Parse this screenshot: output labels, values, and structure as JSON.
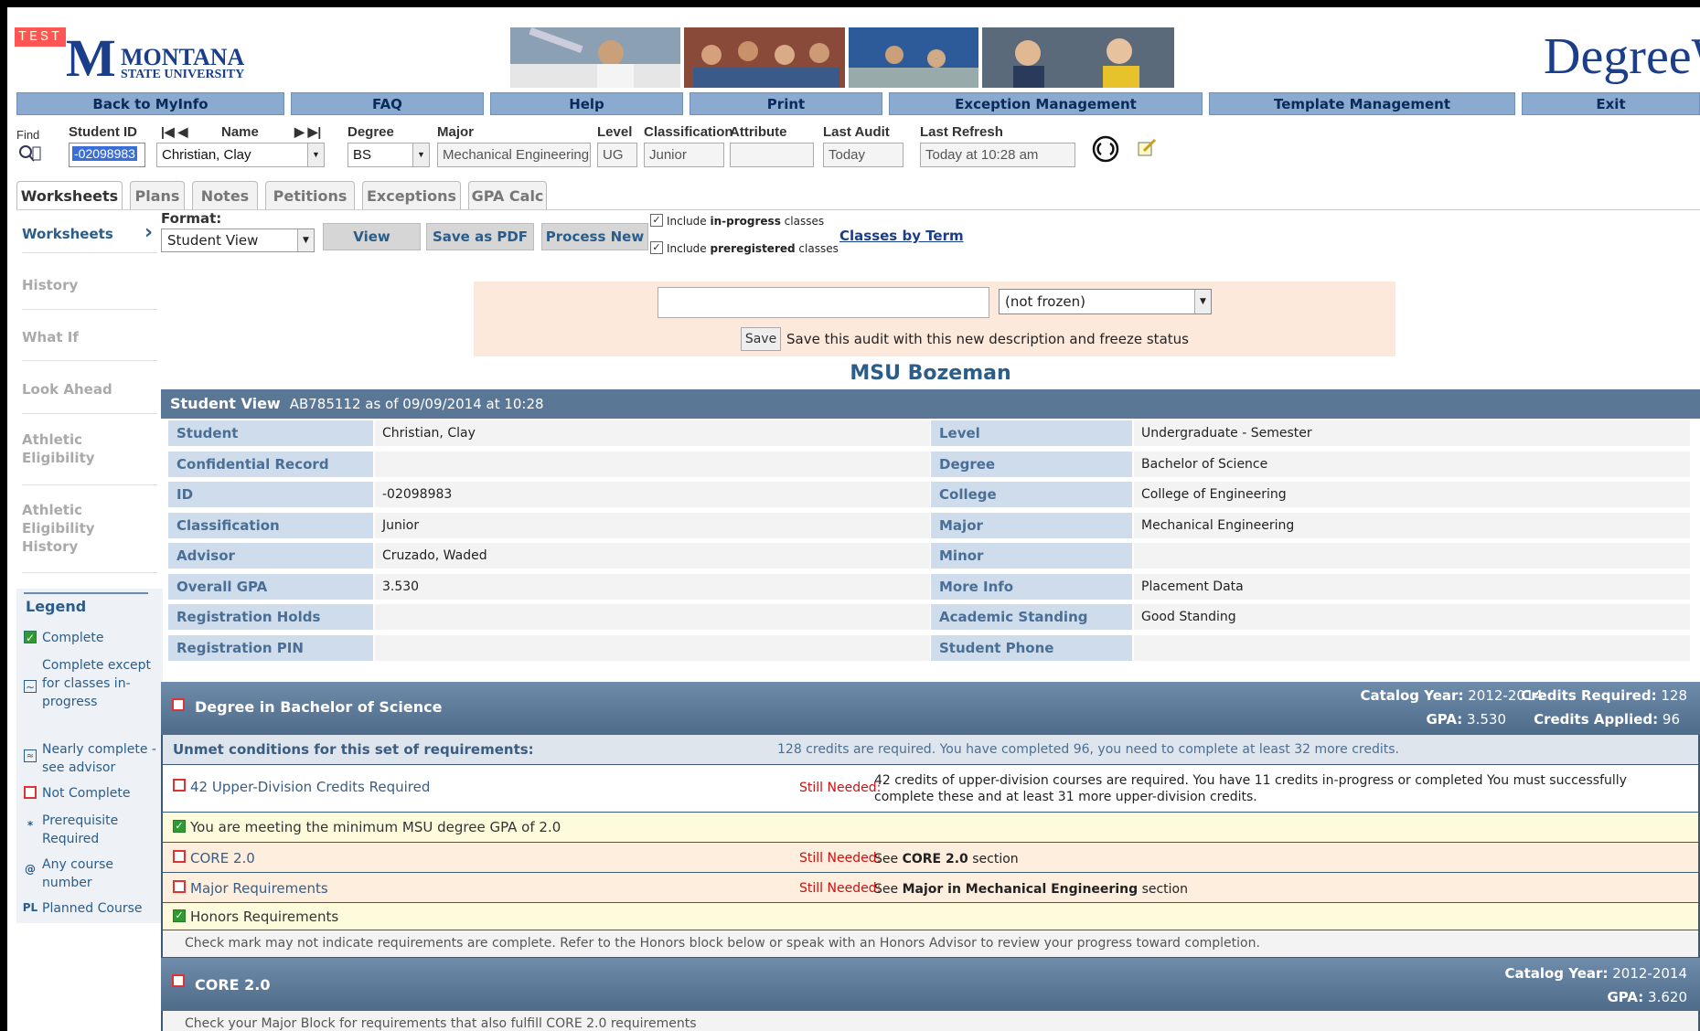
{
  "header": {
    "test_badge": "TEST",
    "logo_letter": "M",
    "university_line1": "MONTANA",
    "university_line2": "STATE UNIVERSITY",
    "brand": "DegreeW"
  },
  "nav": [
    "Back to MyInfo",
    "FAQ",
    "Help",
    "Print",
    "Exception Management",
    "Template Management",
    "Exit"
  ],
  "student_bar": {
    "find_label": "Find",
    "student_id_label": "Student ID",
    "student_id_value": "-02098983",
    "name_label": "Name",
    "name_value": "Christian, Clay",
    "degree_label": "Degree",
    "degree_value": "BS",
    "major_label": "Major",
    "major_value": "Mechanical Engineering",
    "level_label": "Level",
    "level_value": "UG",
    "classification_label": "Classification",
    "classification_value": "Junior",
    "attribute_label": "Attribute",
    "attribute_value": "",
    "last_audit_label": "Last Audit",
    "last_audit_value": "Today",
    "last_refresh_label": "Last Refresh",
    "last_refresh_value": "Today at 10:28 am"
  },
  "tabs": [
    "Worksheets",
    "Plans",
    "Notes",
    "Petitions",
    "Exceptions",
    "GPA Calc"
  ],
  "sidebar": {
    "active": "Worksheets",
    "items": [
      "History",
      "What If",
      "Look Ahead",
      "Athletic Eligibility",
      "Athletic Eligibility History"
    ]
  },
  "legend": {
    "title": "Legend",
    "items": [
      {
        "icon": "check",
        "label": "Complete"
      },
      {
        "icon": "tilde",
        "label": "Complete except for classes in-progress"
      },
      {
        "icon": "double-tilde",
        "label": "Nearly complete - see advisor"
      },
      {
        "icon": "box",
        "label": "Not Complete"
      },
      {
        "icon": "*",
        "label": "Prerequisite Required"
      },
      {
        "icon": "@",
        "label": "Any course number"
      },
      {
        "icon": "PL",
        "label": "Planned Course"
      }
    ]
  },
  "format": {
    "label": "Format:",
    "selected": "Student View",
    "view_button": "View",
    "pdf_button": "Save as PDF",
    "process_button": "Process New",
    "include_prefix": "Include",
    "in_progress_word": "in-progress",
    "preregistered_word": "preregistered",
    "classes_word": "classes",
    "classes_by_term": "Classes by Term"
  },
  "freeze": {
    "description_value": "",
    "status_selected": "(not frozen)",
    "save_button": "Save",
    "save_text": "Save this audit with this new description and freeze status"
  },
  "campus": "MSU Bozeman",
  "student_view": {
    "title": "Student View",
    "subtitle": "AB785112 as of 09/09/2014 at 10:28",
    "left": [
      {
        "label": "Student",
        "value": "Christian, Clay"
      },
      {
        "label": "Confidential Record",
        "value": ""
      },
      {
        "label": "ID",
        "value": "-02098983"
      },
      {
        "label": "Classification",
        "value": "Junior"
      },
      {
        "label": "Advisor",
        "value": "Cruzado, Waded"
      },
      {
        "label": "Overall GPA",
        "value": "3.530"
      },
      {
        "label": "Registration Holds",
        "value": ""
      },
      {
        "label": "Registration PIN",
        "value": ""
      }
    ],
    "right": [
      {
        "label": "Level",
        "value": "Undergraduate - Semester"
      },
      {
        "label": "Degree",
        "value": "Bachelor of Science"
      },
      {
        "label": "College",
        "value": "College of Engineering"
      },
      {
        "label": "Major",
        "value": "Mechanical Engineering"
      },
      {
        "label": "Minor",
        "value": ""
      },
      {
        "label": "More Info",
        "value": "Placement Data"
      },
      {
        "label": "Academic Standing",
        "value": "Good Standing"
      },
      {
        "label": "Student Phone",
        "value": ""
      }
    ]
  },
  "degree_block": {
    "title": "Degree in Bachelor of Science",
    "catalog_year_label": "Catalog Year:",
    "catalog_year": "2012-2014",
    "credits_required_label": "Credits Required:",
    "credits_required": "128",
    "gpa_label": "GPA:",
    "gpa": "3.530",
    "credits_applied_label": "Credits Applied:",
    "credits_applied": "96",
    "unmet_label": "Unmet conditions for this set of requirements:",
    "unmet_text": "128 credits are required. You have completed 96, you need to complete at least 32 more credits.",
    "still_needed": "Still Needed:",
    "upper_div_title": "42 Upper-Division Credits Required",
    "upper_div_text": "42 credits of upper-division courses are required. You have 11 credits in-progress or completed You must successfully complete these and at least 31 more upper-division credits.",
    "gpa_row": "You are meeting the minimum MSU degree GPA of 2.0",
    "core_title": "CORE 2.0",
    "see": "See",
    "core_bold": "CORE 2.0",
    "section": "section",
    "major_title": "Major Requirements",
    "major_bold": "Major in Mechanical Engineering",
    "honors_title": "Honors Requirements",
    "honors_note": "Check mark may not indicate requirements are complete. Refer to the Honors block below or speak with an Honors Advisor to review your progress toward completion."
  },
  "core_block": {
    "title": "CORE 2.0",
    "catalog_year_label": "Catalog Year:",
    "catalog_year": "2012-2014",
    "gpa_label": "GPA:",
    "gpa": "3.620",
    "note": "Check your Major Block for requirements that also fulfill CORE 2.0 requirements"
  },
  "colors": {
    "nav": "#8aaad0",
    "block_header": "#5a7896",
    "label_bg": "#cfdceb",
    "freeze_bg": "#fde9dc",
    "highlight_row": "#fdfbdc",
    "pending_row": "#fdeedd",
    "still_needed": "#cc1111"
  }
}
